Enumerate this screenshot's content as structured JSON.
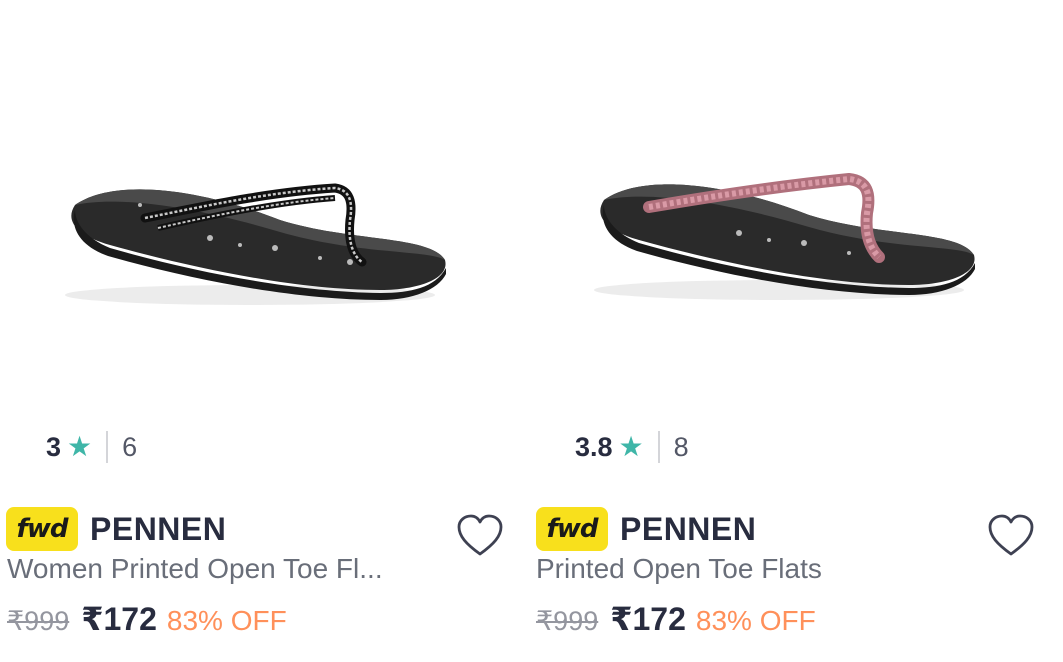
{
  "products": [
    {
      "rating": "3",
      "rating_count": "6",
      "badge": "fwd",
      "brand": "PENNEN",
      "title": "Women Printed Open Toe Fl...",
      "mrp": "₹999",
      "price": "₹172",
      "discount": "83% OFF",
      "strap_color": "#c9c9c9",
      "image_icon": "black-flip-flop-silver-strap"
    },
    {
      "rating": "3.8",
      "rating_count": "8",
      "badge": "fwd",
      "brand": "PENNEN",
      "title": "Printed Open Toe Flats",
      "mrp": "₹999",
      "price": "₹172",
      "discount": "83% OFF",
      "strap_color": "#d99aa6",
      "image_icon": "black-flip-flop-pink-strap"
    }
  ],
  "colors": {
    "star": "#3fb6a8",
    "discount": "#ff905a",
    "badge": "#f8e01c"
  },
  "icons": {
    "rating": "star-icon",
    "wishlist": "heart-icon"
  }
}
